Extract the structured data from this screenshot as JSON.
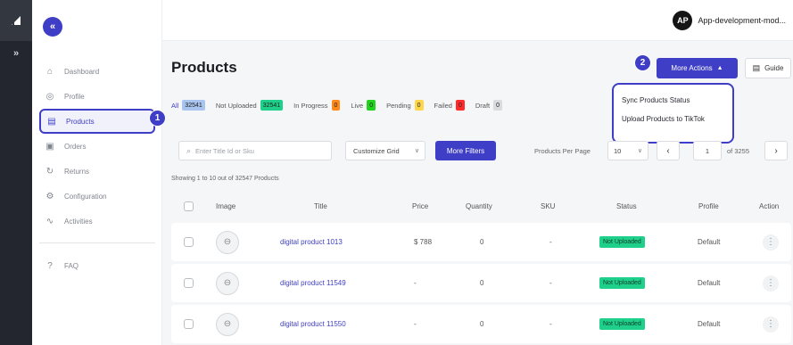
{
  "app": {
    "expand_icon": "double-chevron-right-icon"
  },
  "sidebar": {
    "collapse_icon": "double-chevron-left-icon",
    "items": [
      {
        "label": "Dashboard",
        "icon": "home-icon",
        "glyph": "⌂"
      },
      {
        "label": "Profile",
        "icon": "profile-icon",
        "glyph": "◎"
      },
      {
        "label": "Products",
        "icon": "products-icon",
        "glyph": "▤",
        "active": true
      },
      {
        "label": "Orders",
        "icon": "orders-icon",
        "glyph": "▣"
      },
      {
        "label": "Returns",
        "icon": "returns-icon",
        "glyph": "↻"
      },
      {
        "label": "Configuration",
        "icon": "gear-icon",
        "glyph": "⚙"
      },
      {
        "label": "Activities",
        "icon": "activity-icon",
        "glyph": "∿"
      }
    ],
    "faq": {
      "label": "FAQ",
      "icon": "help-icon",
      "glyph": "?"
    }
  },
  "topbar": {
    "avatar_initials": "AP",
    "store_name": "App-development-mod..."
  },
  "page": {
    "title": "Products",
    "more_actions_label": "More Actions",
    "guide_label": "Guide",
    "dropdown": {
      "options": [
        "Sync Products Status",
        "Upload Products to TikTok"
      ]
    },
    "step_badges": [
      "1",
      "2"
    ]
  },
  "tabs": [
    {
      "label": "All",
      "count": "32541",
      "color": "#a8c4ef",
      "active": true
    },
    {
      "label": "Not Uploaded",
      "count": "32541",
      "color": "#1fd08a"
    },
    {
      "label": "In Progress",
      "count": "0",
      "color": "#ff8a1c"
    },
    {
      "label": "Live",
      "count": "0",
      "color": "#22d31e"
    },
    {
      "label": "Pending",
      "count": "0",
      "color": "#ffd54a"
    },
    {
      "label": "Failed",
      "count": "0",
      "color": "#ff2a2a"
    },
    {
      "label": "Draft",
      "count": "0",
      "color": "#d9dbdf"
    }
  ],
  "filters": {
    "search_placeholder": "Enter Title Id or Sku",
    "customize_grid_label": "Customize Grid",
    "more_filters_label": "More Filters",
    "per_page_label": "Products Per Page",
    "per_page_value": "10",
    "page_value": "1",
    "page_total": "of 3255"
  },
  "showing_text": "Showing 1 to 10 out of 32547 Products",
  "table": {
    "headers": {
      "image": "Image",
      "title": "Title",
      "price": "Price",
      "quantity": "Quantity",
      "sku": "SKU",
      "status": "Status",
      "profile": "Profile",
      "action": "Action"
    },
    "rows": [
      {
        "title": "digital product 1013",
        "price": "$ 788",
        "quantity": "0",
        "sku": "-",
        "status": "Not Uploaded",
        "profile": "Default"
      },
      {
        "title": "digital product 11549",
        "price": "-",
        "quantity": "0",
        "sku": "-",
        "status": "Not Uploaded",
        "profile": "Default"
      },
      {
        "title": "digital product 11550",
        "price": "-",
        "quantity": "0",
        "sku": "-",
        "status": "Not Uploaded",
        "profile": "Default"
      }
    ]
  },
  "colors": {
    "accent": "#3f3ec6",
    "status_green": "#1fd08a",
    "rail_dark": "#23262e"
  }
}
